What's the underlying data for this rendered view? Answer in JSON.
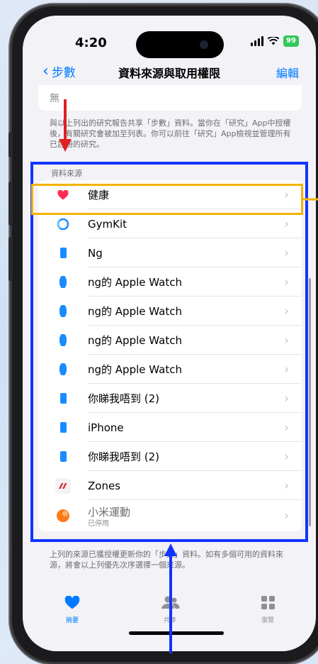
{
  "status": {
    "time": "4:20",
    "battery": "99"
  },
  "nav": {
    "back": "步數",
    "title": "資料來源與取用權限",
    "edit": "編輯"
  },
  "top_card": {
    "value": "無"
  },
  "research_note": "與以上列出的研究報告共享「步數」資料。當你在「研究」App中授權後，有關研究會被加至列表。你可以前往「研究」App檢視並管理所有已註冊的研究。",
  "sources": {
    "header": "資料來源",
    "items": [
      {
        "label": "健康",
        "icon": "heart-icon"
      },
      {
        "label": "GymKit",
        "icon": "gymkit-icon"
      },
      {
        "label": "Ng",
        "icon": "iphone-icon"
      },
      {
        "label": "ng的 Apple Watch",
        "icon": "watch-icon"
      },
      {
        "label": "ng的 Apple Watch",
        "icon": "watch-icon"
      },
      {
        "label": "ng的 Apple Watch",
        "icon": "watch-icon"
      },
      {
        "label": "ng的 Apple Watch",
        "icon": "watch-icon"
      },
      {
        "label": "你睇我唔到 (2)",
        "icon": "iphone-icon"
      },
      {
        "label": "iPhone",
        "icon": "iphone-icon"
      },
      {
        "label": "你睇我唔到 (2)",
        "icon": "iphone-icon"
      },
      {
        "label": "Zones",
        "icon": "zones-icon"
      },
      {
        "label": "小米運動",
        "sub": "已停用",
        "icon": "mi-fit-icon"
      }
    ]
  },
  "bottom_note": "上列的來源已獲授權更新你的「步數」資料。如有多個可用的資料來源，將會以上列優先次序選擇一個來源。",
  "tabs": [
    {
      "label": "摘要",
      "icon": "heart-icon"
    },
    {
      "label": "共享",
      "icon": "people-icon"
    },
    {
      "label": "瀏覽",
      "icon": "grid-icon"
    }
  ],
  "colors": {
    "accent": "#007aff",
    "annotation_red": "#e02020",
    "annotation_blue": "#1234ff",
    "annotation_yellow": "#f4b400"
  }
}
